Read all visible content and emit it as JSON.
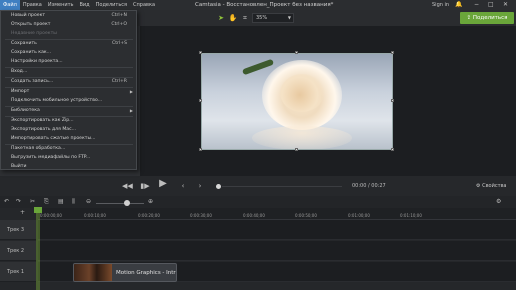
{
  "menubar": {
    "items": [
      "Файл",
      "Правка",
      "Изменить",
      "Вид",
      "Поделиться",
      "Справка"
    ],
    "app_title": "Camtasia - Восстановлен_Проект без названия*",
    "sign_in": "Sign in"
  },
  "toolbar": {
    "zoom_value": "35%",
    "share_label": "Поделиться"
  },
  "file_menu": {
    "items": [
      {
        "label": "Новый проект",
        "shortcut": "Ctrl+N",
        "disabled": false
      },
      {
        "label": "Открыть проект",
        "shortcut": "Ctrl+O",
        "disabled": false
      },
      {
        "label": "Недавние проекты",
        "shortcut": "",
        "disabled": true
      },
      {
        "label": "Сохранить",
        "shortcut": "Ctrl+S",
        "disabled": false
      },
      {
        "label": "Сохранить как...",
        "shortcut": "",
        "disabled": false
      },
      {
        "label": "Настройки проекта...",
        "shortcut": "",
        "disabled": false
      },
      {
        "label": "Вход...",
        "shortcut": "",
        "disabled": false
      },
      {
        "label": "Создать запись...",
        "shortcut": "Ctrl+R",
        "disabled": false
      },
      {
        "label": "Импорт",
        "shortcut": "",
        "disabled": false,
        "submenu": true
      },
      {
        "label": "Подключить мобильное устройство...",
        "shortcut": "",
        "disabled": false
      },
      {
        "label": "Библиотека",
        "shortcut": "",
        "disabled": false,
        "submenu": true
      },
      {
        "label": "Экспортировать как Zip...",
        "shortcut": "",
        "disabled": false
      },
      {
        "label": "Экспортировать для Mac...",
        "shortcut": "",
        "disabled": false
      },
      {
        "label": "Импортировать сжатые проекты...",
        "shortcut": "",
        "disabled": false
      },
      {
        "label": "Пакетная обработка...",
        "shortcut": "",
        "disabled": false
      },
      {
        "label": "Выгрузить медиафайлы по FTP...",
        "shortcut": "",
        "disabled": false
      },
      {
        "label": "Выйти",
        "shortcut": "",
        "disabled": false
      }
    ]
  },
  "playback": {
    "timecode_current": "00:00",
    "timecode_sep": "/",
    "timecode_total": "00:27",
    "properties_label": "Свойства"
  },
  "timeline": {
    "ruler_ticks": [
      "0:00:00;00",
      "0:00:10;00",
      "0:00:20;00",
      "0:00:30;00",
      "0:00:40;00",
      "0:00:50;00",
      "0:01:00;00",
      "0:01:10;00"
    ],
    "tracks": [
      "Трек 3",
      "Трек 2",
      "Трек 1"
    ],
    "clip_label": "Motion Graphics - Intr"
  }
}
